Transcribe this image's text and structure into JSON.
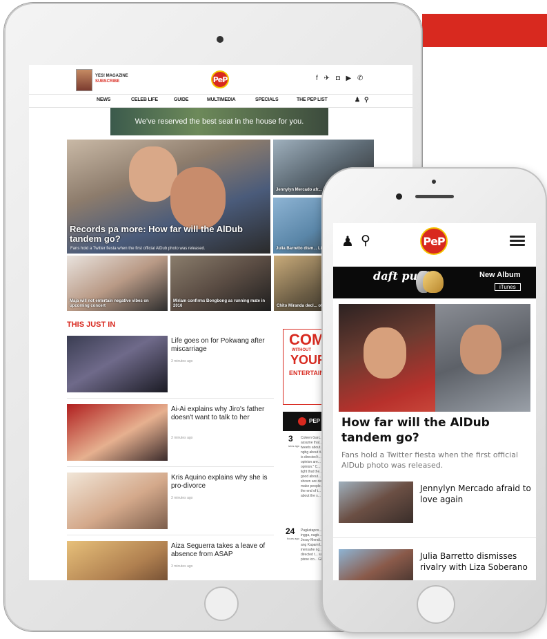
{
  "tablet": {
    "magazine": {
      "name": "YES! MAGAZINE",
      "subscribe": "SUBSCRIBE"
    },
    "logo": "PeP",
    "social": "f ✈ ◘ ▶ ✆",
    "nav": [
      "NEWS",
      "CELEB LIFE",
      "GUIDE",
      "MULTIMEDIA",
      "SPECIALS",
      "THE PEP LIST"
    ],
    "ad_text": "We've reserved the best seat in the house for you.",
    "hero": {
      "title": "Records pa more: How far will the AlDub tandem go?",
      "subtitle": "Fans hold a Twitter fiesta when the first official AlDub photo was released."
    },
    "side_tiles": [
      "Jennylyn Mercado afr... again",
      "Julia Barretto dism... Liza Soberano"
    ],
    "bottom_tiles": [
      "Maja will not entertain negative vibes on upcoming concert",
      "Miriam confirms Bongbong as running mate in 2016",
      "Chito Miranda decl... offer from presiden..."
    ],
    "section_title": "THIS JUST IN",
    "stories": [
      {
        "title": "Life goes on for Pokwang after miscarriage",
        "time": "3 minutes ago"
      },
      {
        "title": "Ai-Ai explains why Jiro's father doesn't want to talk to her",
        "time": "3 minutes ago"
      },
      {
        "title": "Kris Aquino explains why she is pro-divorce",
        "time": "3 minutes ago"
      },
      {
        "title": "Aiza Seguerra takes a leave of absence from ASAP",
        "time": "3 minutes ago"
      }
    ],
    "side_ad": {
      "line1": "COM",
      "line2": "WITHOUT",
      "line3": "YOUR",
      "line4": "ENTERTAIN"
    },
    "pep_bar": "PEP",
    "side_feed": [
      {
        "count": "3",
        "unit": "secs ago",
        "text": "Coleen Garc... assume that... tweets about... ngbg about it... is directed t... opinion are... opinion.\" C... light that the... good about... shown are de... make people... the end of t... about the s..."
      },
      {
        "count": "24",
        "unit": "hours ago",
        "text": "Pagkatapos... ingga, nagb... Jessy Mendi... ang Kapamil... inensahe ng... is directed t... sa pisne ico... GR."
      }
    ]
  },
  "phone": {
    "logo": "PeP",
    "ad": {
      "brand": "daft punk",
      "label": "New Album",
      "store": "iTunes"
    },
    "hero": {
      "title": "How far will the AlDub tandem go?",
      "subtitle": "Fans hold a Twitter fiesta when the first official AlDub photo was released."
    },
    "stories": [
      {
        "title": "Jennylyn Mercado afraid to love again"
      },
      {
        "title": "Julia Barretto dismisses rivalry with Liza Soberano"
      }
    ]
  },
  "colors": {
    "brand_red": "#d8291f",
    "logo_ring": "#f4c400"
  }
}
